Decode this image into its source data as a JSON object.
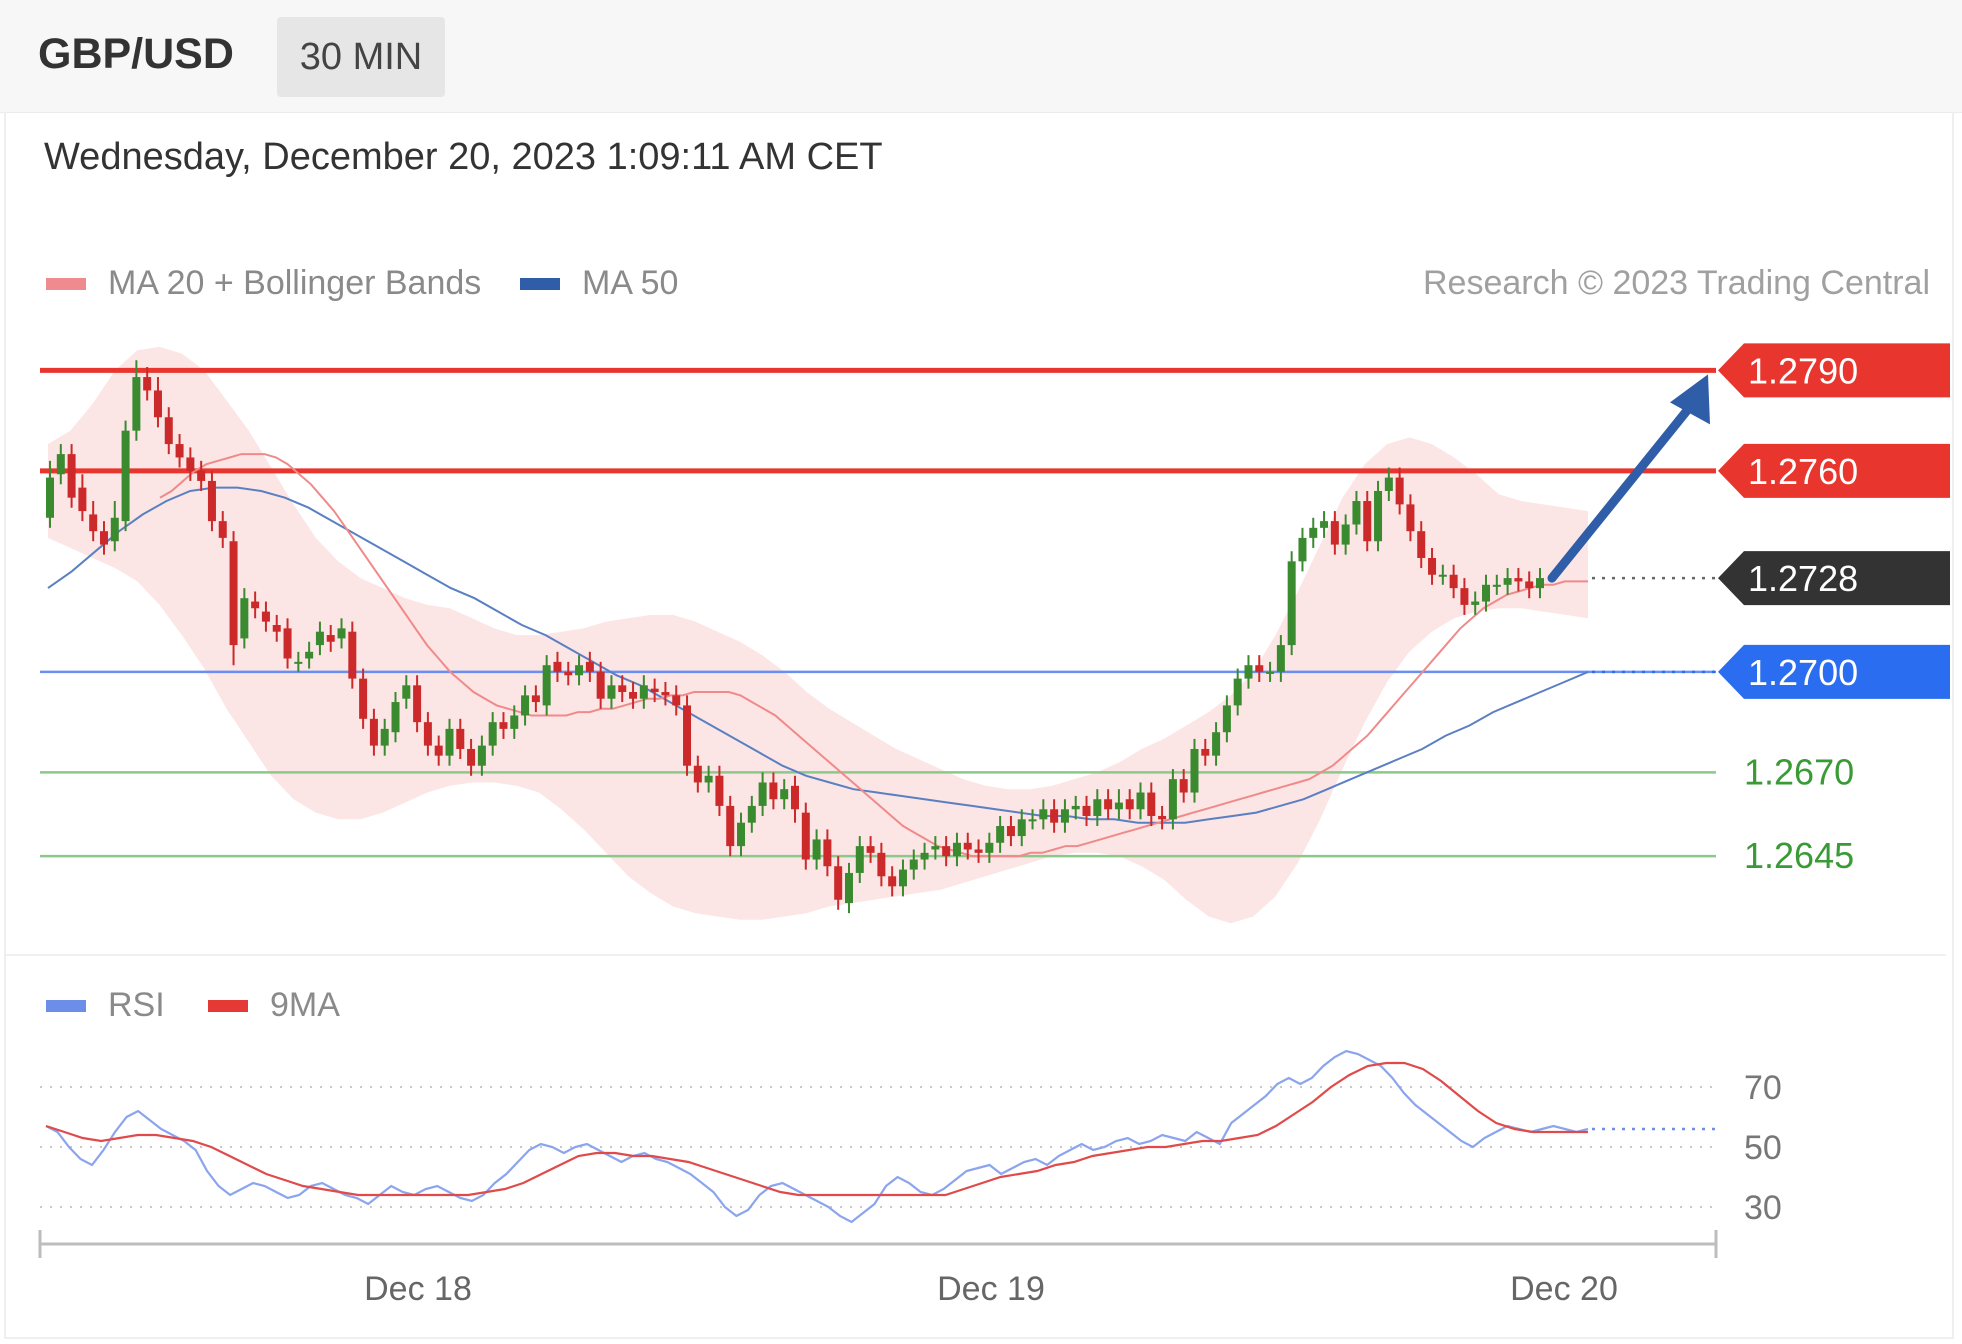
{
  "header": {
    "symbol": "GBP/USD",
    "timeframe": "30 MIN"
  },
  "datetime": "Wednesday, December 20, 2023 1:09:11 AM CET",
  "legend_main": [
    {
      "label": "MA 20 + Bollinger Bands",
      "color": "#ef8a8f"
    },
    {
      "label": "MA 50",
      "color": "#2f5da8"
    }
  ],
  "credit": "Research © 2023 Trading Central",
  "legend_rsi": [
    {
      "label": "RSI",
      "color": "#6c8ee8"
    },
    {
      "label": "9MA",
      "color": "#e53935"
    }
  ],
  "colors": {
    "resistance": "#e8352d",
    "support_blue": "#2a6df0",
    "support_green": "#3a9a35",
    "current": "#333333",
    "candle_up": "#3a8a30",
    "candle_down": "#cc2a2a",
    "band_fill": "#fbe0e0",
    "arrow": "#2f5da8"
  },
  "chart_data": [
    {
      "type": "candlestick",
      "title": "GBP/USD 30 MIN",
      "ylim": [
        1.2617,
        1.2811
      ],
      "x_ticks": [
        "Dec 18",
        "Dec 19",
        "Dec 20"
      ],
      "current_price": "1.2728",
      "levels": [
        {
          "value": 1.279,
          "label": "1.2790",
          "kind": "resistance"
        },
        {
          "value": 1.276,
          "label": "1.2760",
          "kind": "resistance"
        },
        {
          "value": 1.2728,
          "label": "1.2728",
          "kind": "current"
        },
        {
          "value": 1.27,
          "label": "1.2700",
          "kind": "pivot"
        },
        {
          "value": 1.267,
          "label": "1.2670",
          "kind": "support"
        },
        {
          "value": 1.2645,
          "label": "1.2645",
          "kind": "support"
        }
      ],
      "close": [
        1.2758,
        1.2765,
        1.2752,
        1.2748,
        1.2742,
        1.2738,
        1.2746,
        1.2772,
        1.2788,
        1.2784,
        1.2776,
        1.2768,
        1.2764,
        1.276,
        1.2757,
        1.2745,
        1.274,
        1.2708,
        1.2722,
        1.2719,
        1.2715,
        1.2712,
        1.2704,
        1.2703,
        1.2706,
        1.2712,
        1.2709,
        1.2713,
        1.2698,
        1.2686,
        1.2678,
        1.2683,
        1.2691,
        1.2696,
        1.2685,
        1.2678,
        1.2675,
        1.2683,
        1.2677,
        1.2672,
        1.2678,
        1.2685,
        1.2683,
        1.2687,
        1.2693,
        1.2691,
        1.2702,
        1.27,
        1.2699,
        1.2702,
        1.27,
        1.2692,
        1.2696,
        1.2694,
        1.2692,
        1.2696,
        1.2694,
        1.2693,
        1.269,
        1.2672,
        1.2667,
        1.2669,
        1.266,
        1.2648,
        1.2655,
        1.266,
        1.2667,
        1.2662,
        1.2665,
        1.2659,
        1.2644,
        1.265,
        1.2642,
        1.2632,
        1.264,
        1.2648,
        1.2646,
        1.2639,
        1.2636,
        1.2641,
        1.2644,
        1.2646,
        1.2648,
        1.2645,
        1.2649,
        1.2647,
        1.2646,
        1.2649,
        1.2654,
        1.2651,
        1.2656,
        1.2656,
        1.2659,
        1.2655,
        1.2659,
        1.266,
        1.2657,
        1.2662,
        1.2659,
        1.2661,
        1.2659,
        1.2664,
        1.2657,
        1.2656,
        1.2668,
        1.2664,
        1.2677,
        1.2675,
        1.2682,
        1.269,
        1.2698,
        1.2702,
        1.27,
        1.27,
        1.2708,
        1.2733,
        1.274,
        1.2743,
        1.2745,
        1.2738,
        1.2744,
        1.2751,
        1.2739,
        1.2754,
        1.2758,
        1.275,
        1.2742,
        1.2734,
        1.2729,
        1.2729,
        1.2725,
        1.272,
        1.2721,
        1.2726,
        1.2726,
        1.2728,
        1.2727,
        1.2725,
        1.2728
      ],
      "open": [
        1.2746,
        1.2759,
        1.2765,
        1.2755,
        1.2747,
        1.2742,
        1.2739,
        1.2745,
        1.2772,
        1.2788,
        1.2784,
        1.2776,
        1.2768,
        1.2764,
        1.276,
        1.2757,
        1.2745,
        1.2739,
        1.271,
        1.2721,
        1.2718,
        1.2714,
        1.2713,
        1.2703,
        1.2704,
        1.2708,
        1.2711,
        1.271,
        1.2712,
        1.2698,
        1.2686,
        1.2678,
        1.2682,
        1.2692,
        1.2696,
        1.2685,
        1.2678,
        1.2675,
        1.2683,
        1.2677,
        1.2672,
        1.2678,
        1.2685,
        1.2683,
        1.2687,
        1.2693,
        1.269,
        1.2703,
        1.27,
        1.2699,
        1.2703,
        1.27,
        1.2692,
        1.2696,
        1.2694,
        1.2692,
        1.2695,
        1.2694,
        1.2693,
        1.269,
        1.2672,
        1.2667,
        1.2669,
        1.266,
        1.2648,
        1.2655,
        1.266,
        1.2667,
        1.2662,
        1.2666,
        1.2658,
        1.2644,
        1.265,
        1.2642,
        1.2631,
        1.264,
        1.2648,
        1.2646,
        1.2639,
        1.2636,
        1.2641,
        1.2644,
        1.2647,
        1.2648,
        1.2645,
        1.2649,
        1.2647,
        1.2646,
        1.2649,
        1.2654,
        1.2651,
        1.2656,
        1.2656,
        1.2659,
        1.2655,
        1.2659,
        1.266,
        1.2657,
        1.2662,
        1.2659,
        1.2662,
        1.2659,
        1.2664,
        1.2657,
        1.2656,
        1.2668,
        1.2664,
        1.2677,
        1.2675,
        1.2682,
        1.269,
        1.2698,
        1.2702,
        1.27,
        1.27,
        1.2708,
        1.2733,
        1.274,
        1.2743,
        1.2745,
        1.2738,
        1.2744,
        1.2751,
        1.2739,
        1.2754,
        1.2758,
        1.275,
        1.2742,
        1.2734,
        1.2729,
        1.2729,
        1.2725,
        1.272,
        1.2721,
        1.2726,
        1.2726,
        1.2728,
        1.2727,
        1.2725
      ],
      "high": [
        1.2763,
        1.2768,
        1.2768,
        1.2759,
        1.2751,
        1.2745,
        1.2751,
        1.2775,
        1.2793,
        1.2791,
        1.2788,
        1.2779,
        1.2771,
        1.2767,
        1.2763,
        1.276,
        1.2748,
        1.2742,
        1.2725,
        1.2724,
        1.2721,
        1.2717,
        1.2716,
        1.2706,
        1.2709,
        1.2715,
        1.2714,
        1.2716,
        1.2715,
        1.2701,
        1.2689,
        1.2686,
        1.2694,
        1.2699,
        1.2699,
        1.2688,
        1.2681,
        1.2686,
        1.2686,
        1.268,
        1.2681,
        1.2688,
        1.2688,
        1.269,
        1.2696,
        1.2696,
        1.2705,
        1.2706,
        1.2703,
        1.2705,
        1.2706,
        1.2703,
        1.2699,
        1.2699,
        1.2697,
        1.2699,
        1.2698,
        1.2697,
        1.2696,
        1.2693,
        1.2675,
        1.2672,
        1.2672,
        1.2663,
        1.2658,
        1.2663,
        1.267,
        1.267,
        1.2668,
        1.2669,
        1.2661,
        1.2653,
        1.2653,
        1.2645,
        1.2643,
        1.2651,
        1.2651,
        1.2649,
        1.2642,
        1.2644,
        1.2647,
        1.2649,
        1.2651,
        1.2651,
        1.2652,
        1.2652,
        1.265,
        1.2652,
        1.2657,
        1.2657,
        1.2659,
        1.2659,
        1.2662,
        1.2662,
        1.2662,
        1.2663,
        1.2663,
        1.2665,
        1.2665,
        1.2665,
        1.2665,
        1.2667,
        1.2667,
        1.266,
        1.2671,
        1.2671,
        1.268,
        1.268,
        1.2685,
        1.2693,
        1.2701,
        1.2705,
        1.2705,
        1.2703,
        1.2711,
        1.2736,
        1.2743,
        1.2746,
        1.2748,
        1.2748,
        1.2747,
        1.2754,
        1.2754,
        1.2757,
        1.2761,
        1.2761,
        1.2753,
        1.2745,
        1.2737,
        1.2732,
        1.2732,
        1.2728,
        1.2724,
        1.2729,
        1.2729,
        1.2731,
        1.2731,
        1.273,
        1.2731
      ],
      "low": [
        1.2743,
        1.2756,
        1.2749,
        1.2745,
        1.2739,
        1.2735,
        1.2736,
        1.2742,
        1.2769,
        1.2781,
        1.2773,
        1.2765,
        1.2761,
        1.2757,
        1.2754,
        1.2742,
        1.2737,
        1.2702,
        1.2707,
        1.2716,
        1.2712,
        1.2709,
        1.2701,
        1.27,
        1.2701,
        1.2705,
        1.2706,
        1.2707,
        1.2695,
        1.2683,
        1.2675,
        1.2675,
        1.2679,
        1.2689,
        1.2682,
        1.2675,
        1.2672,
        1.2672,
        1.2674,
        1.2669,
        1.2669,
        1.2675,
        1.268,
        1.268,
        1.2684,
        1.2688,
        1.2687,
        1.2697,
        1.2696,
        1.2696,
        1.2697,
        1.2689,
        1.2689,
        1.2691,
        1.2689,
        1.2689,
        1.2691,
        1.269,
        1.2687,
        1.2669,
        1.2664,
        1.2664,
        1.2657,
        1.2645,
        1.2645,
        1.2652,
        1.2657,
        1.2659,
        1.2659,
        1.2655,
        1.2641,
        1.2641,
        1.2639,
        1.2629,
        1.2628,
        1.2637,
        1.2643,
        1.2636,
        1.2633,
        1.2633,
        1.2638,
        1.2641,
        1.2644,
        1.2642,
        1.2642,
        1.2644,
        1.2643,
        1.2643,
        1.2646,
        1.2648,
        1.2648,
        1.2653,
        1.2653,
        1.2652,
        1.2652,
        1.2656,
        1.2654,
        1.2654,
        1.2656,
        1.2656,
        1.2656,
        1.2656,
        1.2654,
        1.2653,
        1.2653,
        1.2661,
        1.2661,
        1.2672,
        1.2672,
        1.2679,
        1.2687,
        1.2695,
        1.2697,
        1.2697,
        1.2697,
        1.2705,
        1.273,
        1.2737,
        1.274,
        1.2735,
        1.2735,
        1.2741,
        1.2736,
        1.2736,
        1.2751,
        1.2747,
        1.2739,
        1.2731,
        1.2726,
        1.2726,
        1.2722,
        1.2717,
        1.2717,
        1.2718,
        1.2723,
        1.2723,
        1.2724,
        1.2722,
        1.2722
      ],
      "ma20": [
        1.2752,
        1.2754,
        1.2757,
        1.276,
        1.2762,
        1.2763,
        1.2764,
        1.2765,
        1.2765,
        1.2765,
        1.2764,
        1.2762,
        1.2759,
        1.2756,
        1.2752,
        1.2748,
        1.2743,
        1.2738,
        1.2733,
        1.2728,
        1.2723,
        1.2718,
        1.2713,
        1.2708,
        1.2704,
        1.27,
        1.2697,
        1.2694,
        1.2692,
        1.269,
        1.2689,
        1.2688,
        1.2687,
        1.2687,
        1.2687,
        1.2687,
        1.2688,
        1.2688,
        1.2689,
        1.2689,
        1.269,
        1.2691,
        1.2692,
        1.2692,
        1.2693,
        1.2693,
        1.2694,
        1.2694,
        1.2694,
        1.2694,
        1.2693,
        1.2691,
        1.2689,
        1.2687,
        1.2684,
        1.2681,
        1.2678,
        1.2675,
        1.2672,
        1.2669,
        1.2666,
        1.2663,
        1.266,
        1.2657,
        1.2654,
        1.2652,
        1.265,
        1.2648,
        1.2647,
        1.2646,
        1.2645,
        1.2645,
        1.2645,
        1.2645,
        1.2645,
        1.2646,
        1.2646,
        1.2647,
        1.2648,
        1.2648,
        1.2649,
        1.265,
        1.2651,
        1.2652,
        1.2653,
        1.2654,
        1.2655,
        1.2656,
        1.2657,
        1.2658,
        1.2659,
        1.266,
        1.2661,
        1.2662,
        1.2663,
        1.2664,
        1.2665,
        1.2666,
        1.2667,
        1.2668,
        1.267,
        1.2672,
        1.2675,
        1.2678,
        1.2681,
        1.2685,
        1.2689,
        1.2693,
        1.2697,
        1.2701,
        1.2705,
        1.2709,
        1.2713,
        1.2716,
        1.2719,
        1.2721,
        1.2723,
        1.2724,
        1.2725,
        1.2726,
        1.2726,
        1.2727,
        1.2727,
        1.2727
      ],
      "ma50": [
        1.2725,
        1.273,
        1.2736,
        1.2742,
        1.2747,
        1.2751,
        1.2754,
        1.2755,
        1.2755,
        1.2754,
        1.2752,
        1.2749,
        1.2745,
        1.2741,
        1.2737,
        1.2733,
        1.2729,
        1.2725,
        1.2722,
        1.2718,
        1.2714,
        1.2711,
        1.2707,
        1.2703,
        1.2699,
        1.2696,
        1.2692,
        1.2688,
        1.2684,
        1.268,
        1.2676,
        1.2672,
        1.2669,
        1.2667,
        1.2665,
        1.2664,
        1.2663,
        1.2662,
        1.2661,
        1.266,
        1.2659,
        1.2658,
        1.2657,
        1.2657,
        1.2656,
        1.2656,
        1.2655,
        1.2655,
        1.2655,
        1.2656,
        1.2657,
        1.2658,
        1.266,
        1.2662,
        1.2665,
        1.2668,
        1.2671,
        1.2674,
        1.2677,
        1.2681,
        1.2684,
        1.2688,
        1.2691,
        1.2694,
        1.2697,
        1.27
      ],
      "band_upper": [
        1.2768,
        1.2772,
        1.278,
        1.279,
        1.2796,
        1.2797,
        1.2795,
        1.279,
        1.2781,
        1.2772,
        1.2761,
        1.275,
        1.274,
        1.2733,
        1.2728,
        1.2725,
        1.2722,
        1.272,
        1.2719,
        1.2716,
        1.2713,
        1.2711,
        1.2711,
        1.2712,
        1.2713,
        1.2715,
        1.2716,
        1.2717,
        1.2717,
        1.2715,
        1.2712,
        1.2709,
        1.2705,
        1.27,
        1.2694,
        1.2689,
        1.2685,
        1.2681,
        1.2677,
        1.2674,
        1.2671,
        1.2668,
        1.2666,
        1.2665,
        1.2665,
        1.2666,
        1.2668,
        1.267,
        1.2673,
        1.2677,
        1.268,
        1.2684,
        1.2688,
        1.2693,
        1.27,
        1.2711,
        1.2724,
        1.2738,
        1.2752,
        1.2762,
        1.2768,
        1.277,
        1.2768,
        1.2764,
        1.2759,
        1.2753,
        1.2751,
        1.275,
        1.2749,
        1.2748
      ],
      "band_lower": [
        1.274,
        1.2737,
        1.2734,
        1.2731,
        1.2727,
        1.272,
        1.2711,
        1.2701,
        1.2689,
        1.2679,
        1.2669,
        1.2662,
        1.2658,
        1.2656,
        1.2656,
        1.2658,
        1.2661,
        1.2664,
        1.2666,
        1.2667,
        1.2667,
        1.2666,
        1.2664,
        1.2659,
        1.2653,
        1.2646,
        1.2639,
        1.2634,
        1.263,
        1.2628,
        1.2627,
        1.2626,
        1.2626,
        1.2627,
        1.2628,
        1.263,
        1.2631,
        1.2632,
        1.2633,
        1.2634,
        1.2635,
        1.2637,
        1.2639,
        1.2641,
        1.2643,
        1.2645,
        1.2646,
        1.2646,
        1.2645,
        1.2642,
        1.2638,
        1.2632,
        1.2627,
        1.2625,
        1.2627,
        1.2633,
        1.2643,
        1.2656,
        1.2671,
        1.2685,
        1.2697,
        1.2706,
        1.2712,
        1.2716,
        1.2718,
        1.2719,
        1.2719,
        1.2718,
        1.2717,
        1.2716
      ]
    },
    {
      "type": "line",
      "title": "RSI",
      "y_ticks": [
        "70",
        "50",
        "30"
      ],
      "ylim": [
        22,
        85
      ],
      "series": [
        {
          "name": "RSI",
          "values": [
            57,
            55,
            50,
            46,
            44,
            49,
            55,
            60,
            62,
            59,
            56,
            54,
            52,
            49,
            42,
            37,
            34,
            36,
            38,
            37,
            35,
            33,
            34,
            37,
            38,
            36,
            34,
            33,
            31,
            34,
            37,
            35,
            34,
            36,
            37,
            35,
            33,
            32,
            34,
            38,
            41,
            45,
            49,
            51,
            50,
            48,
            50,
            51,
            49,
            47,
            45,
            47,
            48,
            46,
            45,
            43,
            41,
            38,
            35,
            30,
            27,
            29,
            34,
            37,
            38,
            36,
            34,
            32,
            30,
            27,
            25,
            28,
            31,
            37,
            40,
            38,
            35,
            34,
            36,
            39,
            42,
            43,
            44,
            41,
            43,
            45,
            46,
            44,
            47,
            49,
            51,
            49,
            50,
            52,
            53,
            51,
            52,
            54,
            53,
            52,
            55,
            53,
            51,
            58,
            61,
            64,
            67,
            71,
            73,
            71,
            73,
            77,
            80,
            82,
            81,
            79,
            77,
            73,
            68,
            64,
            61,
            58,
            55,
            52,
            50,
            53,
            55,
            57,
            56,
            55,
            56,
            57,
            56,
            55,
            56
          ]
        },
        {
          "name": "9MA",
          "values": [
            57,
            55,
            53,
            52,
            53,
            54,
            54,
            53,
            52,
            50,
            47,
            44,
            41,
            39,
            37,
            36,
            35,
            34,
            34,
            34,
            34,
            34,
            34,
            34,
            35,
            36,
            38,
            41,
            44,
            47,
            48,
            48,
            47,
            47,
            46,
            45,
            43,
            41,
            39,
            37,
            35,
            34,
            34,
            34,
            34,
            34,
            34,
            34,
            34,
            34,
            36,
            38,
            40,
            41,
            42,
            44,
            45,
            47,
            48,
            49,
            50,
            50,
            51,
            52,
            52,
            53,
            54,
            57,
            61,
            65,
            70,
            74,
            77,
            78,
            78,
            76,
            72,
            67,
            62,
            58,
            56,
            55,
            55,
            55,
            55
          ]
        }
      ]
    }
  ]
}
